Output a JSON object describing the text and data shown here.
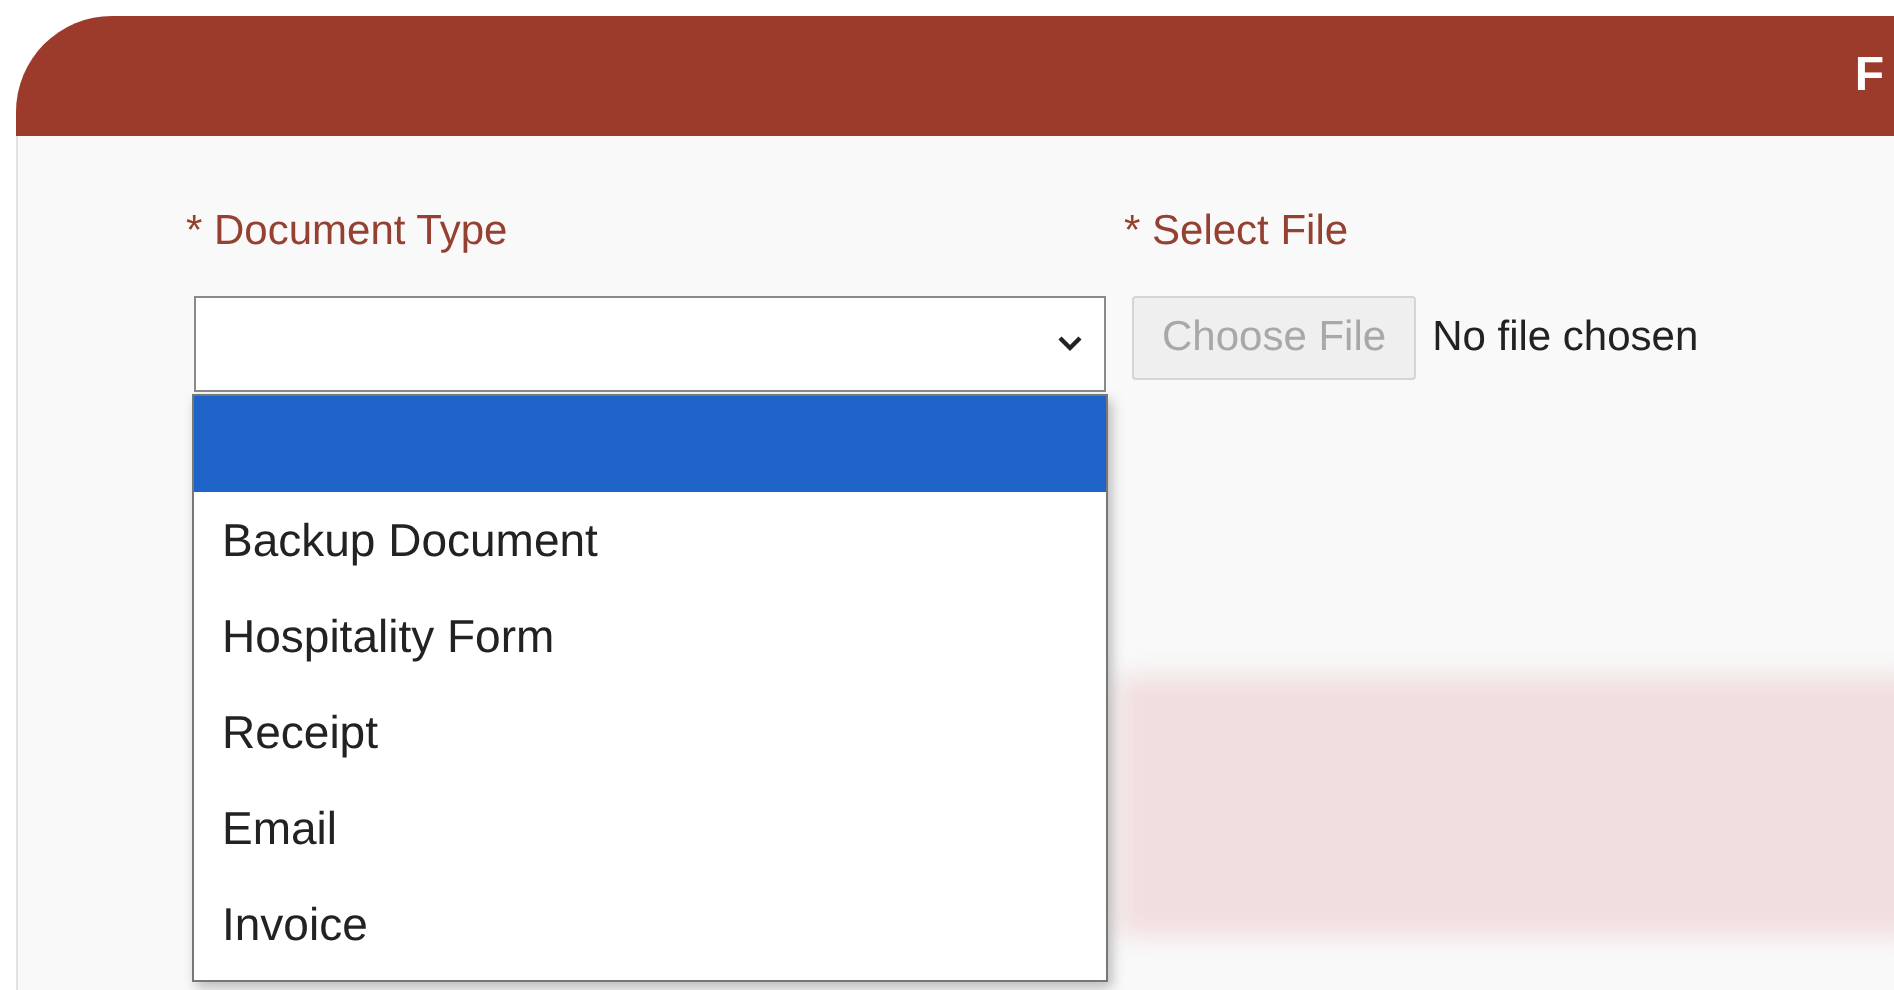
{
  "header": {
    "title": "F"
  },
  "fields": [
    {
      "label": "* Document Type"
    },
    {
      "label": "* Select File"
    }
  ],
  "file_input": {
    "button": "Choose File",
    "status": "No file chosen"
  },
  "dropdown": {
    "expanded": true,
    "options": [
      {
        "selected": true
      },
      {
        "label": "Backup Document",
        "selected": false
      },
      {
        "label": "Hospitality Form",
        "selected": false
      },
      {
        "label": "Receipt",
        "selected": false
      },
      {
        "label": "Email",
        "selected": false
      },
      {
        "label": "Invoice",
        "selected": false
      }
    ]
  }
}
